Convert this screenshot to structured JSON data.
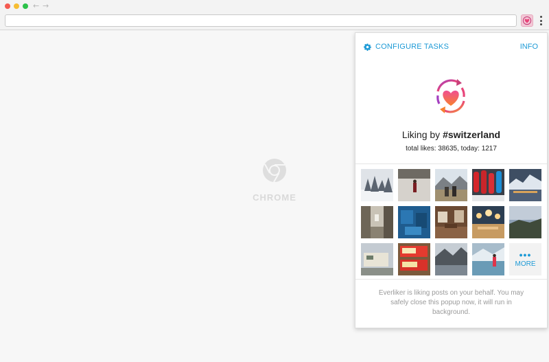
{
  "browser": {
    "back_icon": "back-arrow-icon",
    "forward_icon": "forward-arrow-icon",
    "url": "",
    "menu_icon": "kebab-menu-icon",
    "extension_icon": "everliker-heart-icon"
  },
  "page": {
    "placeholder_label": "CHROME"
  },
  "popup": {
    "configure_label": "CONFIGURE TASKS",
    "configure_icon": "gear-icon",
    "info_label": "INFO",
    "status_prefix": "Liking by ",
    "hashtag": "#switzerland",
    "stats": "total likes: 38635, today: 1217",
    "more_dots": "•••",
    "more_label": "MORE",
    "footer": "Everliker is liking posts on your behalf. You may safely close this popup now, it will run in background.",
    "colors": {
      "accent": "#1d9ad6",
      "heart_top": "#f45b8b",
      "heart_bottom": "#f7812f"
    },
    "thumbnails": [
      {
        "name": "snowy-forest"
      },
      {
        "name": "person-on-pier"
      },
      {
        "name": "mountain-valley-people"
      },
      {
        "name": "red-swiss-knives"
      },
      {
        "name": "alpine-lake-town"
      },
      {
        "name": "old-town-street"
      },
      {
        "name": "blue-abstract"
      },
      {
        "name": "wooden-interior"
      },
      {
        "name": "chandelier-hall"
      },
      {
        "name": "misty-sunrise"
      },
      {
        "name": "building-sign"
      },
      {
        "name": "chocolate-packs"
      },
      {
        "name": "lake-mountains"
      },
      {
        "name": "person-by-lake"
      }
    ]
  }
}
